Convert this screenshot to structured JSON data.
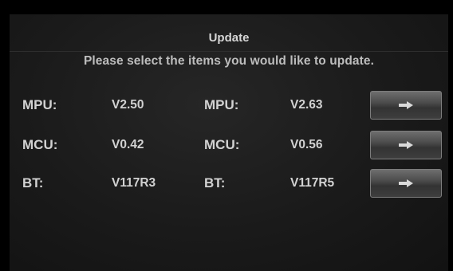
{
  "header": {
    "title": "Update"
  },
  "instruction": "Please select the items you would like to update.",
  "rows": [
    {
      "label": "MPU:",
      "current_version": "V2.50",
      "new_label": "MPU:",
      "new_version": "V2.63",
      "button_icon": "arrow-right-icon"
    },
    {
      "label": "MCU:",
      "current_version": "V0.42",
      "new_label": "MCU:",
      "new_version": "V0.56",
      "button_icon": "arrow-right-icon"
    },
    {
      "label": "BT:",
      "current_version": "V117R3",
      "new_label": "BT:",
      "new_version": "V117R5",
      "button_icon": "arrow-right-icon"
    }
  ],
  "colors": {
    "background": "#1a1a1a",
    "text": "#d2d2d2",
    "button": "#4c4c4c"
  }
}
